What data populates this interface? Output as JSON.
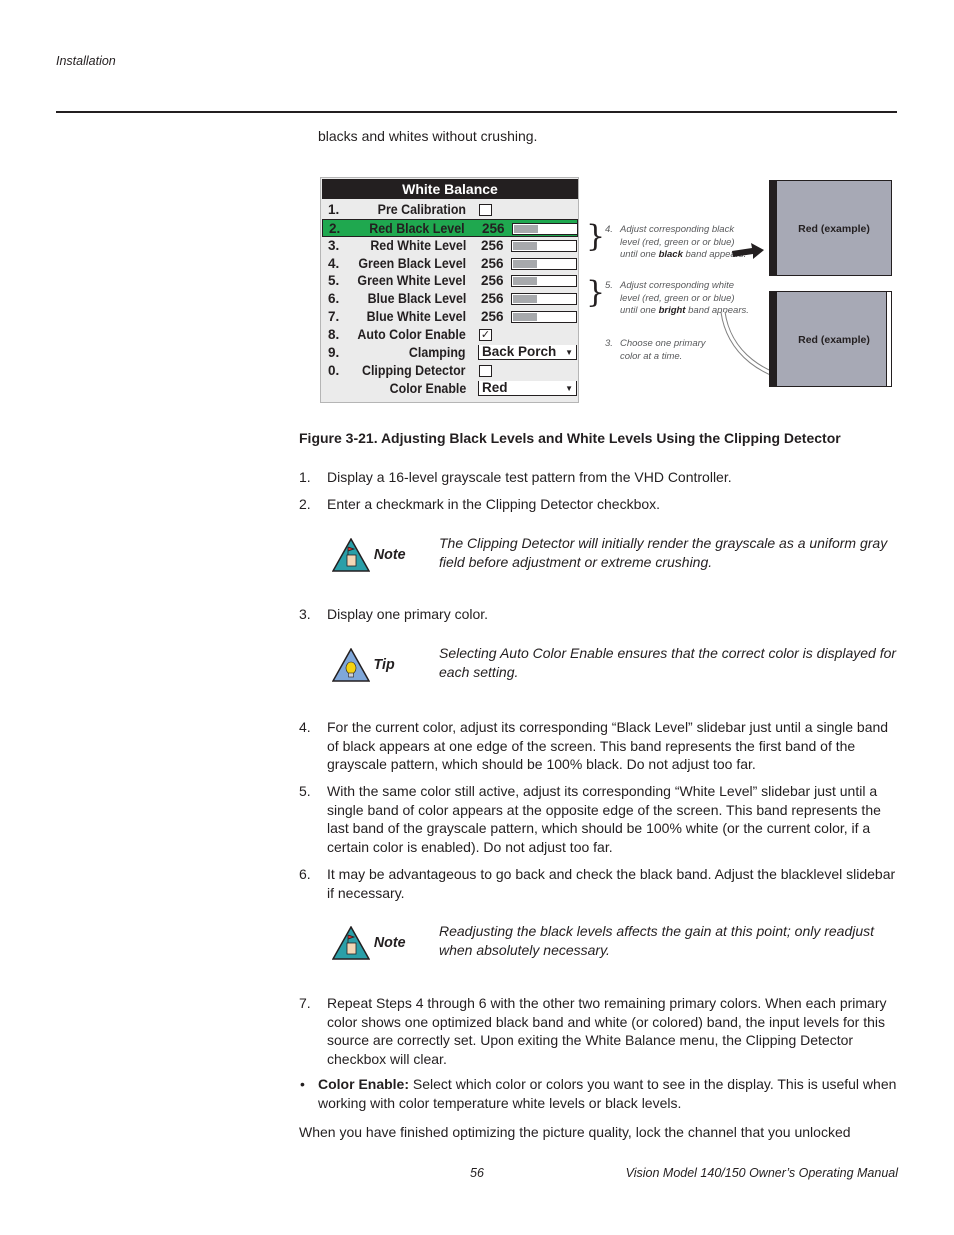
{
  "header": {
    "running_head": "Installation"
  },
  "intro_text": "blacks and whites without crushing.",
  "menu": {
    "title": "White Balance",
    "rows": [
      {
        "num": "1.",
        "label": "Pre Calibration",
        "type": "checkbox",
        "checked": false,
        "check_glyph": ""
      },
      {
        "num": "2.",
        "label": "Red Black Level",
        "type": "slider",
        "value": "256",
        "fill_fraction": 0.38,
        "selected": true
      },
      {
        "num": "3.",
        "label": "Red White Level",
        "type": "slider",
        "value": "256",
        "fill_fraction": 0.38
      },
      {
        "num": "4.",
        "label": "Green Black Level",
        "type": "slider",
        "value": "256",
        "fill_fraction": 0.38
      },
      {
        "num": "5.",
        "label": "Green White Level",
        "type": "slider",
        "value": "256",
        "fill_fraction": 0.38
      },
      {
        "num": "6.",
        "label": "Blue Black Level",
        "type": "slider",
        "value": "256",
        "fill_fraction": 0.38
      },
      {
        "num": "7.",
        "label": "Blue White Level",
        "type": "slider",
        "value": "256",
        "fill_fraction": 0.38
      },
      {
        "num": "8.",
        "label": "Auto Color Enable",
        "type": "checkbox",
        "checked": true,
        "check_glyph": "✓"
      },
      {
        "num": "9.",
        "label": "Clamping",
        "type": "dropdown",
        "value": "Back Porch"
      },
      {
        "num": "0.",
        "label": "Clipping Detector",
        "type": "checkbox",
        "checked": false,
        "check_glyph": ""
      },
      {
        "num": "",
        "label": "Color Enable",
        "type": "dropdown",
        "value": "Red"
      }
    ],
    "dropdown_arrow": "▼",
    "selected_color": "#1fa84f"
  },
  "annotations": [
    {
      "num": "4.",
      "pre": "Adjust corresponding black level (red, green or or blue) until one ",
      "bold": "black",
      "post": " band appears."
    },
    {
      "num": "5.",
      "pre": "Adjust corresponding white level (red, green or or blue) until one ",
      "bold": "bright",
      "post": " band appears."
    },
    {
      "num": "3.",
      "pre": "Choose one primary color at a time.",
      "bold": "",
      "post": ""
    }
  ],
  "screens": [
    {
      "label": "Red (example)",
      "band": "black-left"
    },
    {
      "label": "Red (example)",
      "band": "black-left-white-right"
    }
  ],
  "figure_caption": "Figure 3-21. Adjusting Black Levels and White Levels Using the Clipping Detector",
  "steps": [
    {
      "num": "1.",
      "text": "Display a 16-level grayscale test pattern from the VHD Controller."
    },
    {
      "num": "2.",
      "text": "Enter a checkmark in the Clipping Detector checkbox."
    },
    {
      "num": "3.",
      "text": "Display one primary color."
    },
    {
      "num": "4.",
      "text": "For the current color, adjust its corresponding “Black Level” slidebar just until a single band of black appears at one edge of the screen. This band represents the first band of the grayscale pattern, which should be 100% black. Do not adjust too far."
    },
    {
      "num": "5.",
      "text": "With the same color still active, adjust its corresponding “White Level” slidebar just until a single band of color appears at the opposite edge of the screen. This band represents the last band of the grayscale pattern, which should be 100% white (or the current color, if a certain color is enabled). Do not adjust too far."
    },
    {
      "num": "6.",
      "text": "It may be advantageous to go back and check the black band. Adjust the blacklevel slidebar if necessary."
    },
    {
      "num": "7.",
      "text": "Repeat Steps 4 through 6 with the other two remaining primary colors. When each primary color shows one optimized black band and white (or colored) band, the input levels for this source are correctly set. Upon exiting the White Balance menu, the Clipping Detector checkbox will clear."
    }
  ],
  "callouts": [
    {
      "kind": "Note",
      "icon": "note-hand-icon",
      "text": "The Clipping Detector will initially render the grayscale as a uniform gray field before adjustment or extreme crushing."
    },
    {
      "kind": "Tip",
      "icon": "lightbulb-icon",
      "text": "Selecting Auto Color Enable ensures that the correct color is displayed for each setting."
    },
    {
      "kind": "Note",
      "icon": "note-hand-icon",
      "text": "Readjusting the black levels affects the gain at this point; only readjust when absolutely necessary."
    }
  ],
  "bullet": {
    "glyph": "•",
    "term": "Color Enable:",
    "text": " Select which color or colors you want to see in the display. This is useful when working with color temperature white levels or black levels."
  },
  "closing_text": "When you have finished optimizing the picture quality, lock the channel that you unlocked",
  "footer": {
    "page_number": "56",
    "manual_title": "Vision Model 140/150 Owner’s Operating Manual"
  }
}
